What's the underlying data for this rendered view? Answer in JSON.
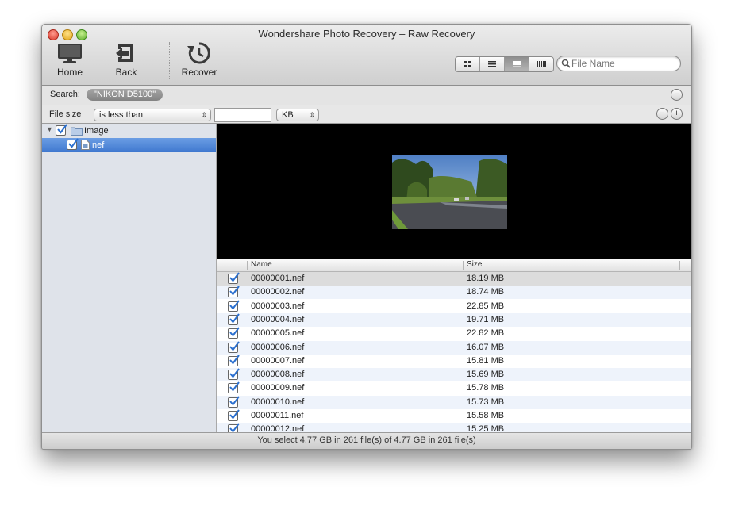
{
  "window": {
    "title": "Wondershare Photo Recovery – Raw Recovery"
  },
  "toolbar": {
    "buttons": [
      {
        "label": "Home",
        "icon": "monitor-icon"
      },
      {
        "label": "Back",
        "icon": "back-arrow-icon"
      },
      {
        "label": "Recover",
        "icon": "history-clock-icon"
      }
    ],
    "view_modes": [
      {
        "name": "grid-view-icon",
        "active": false
      },
      {
        "name": "list-view-icon",
        "active": false
      },
      {
        "name": "preview-view-icon",
        "active": true
      },
      {
        "name": "filmstrip-view-icon",
        "active": false
      }
    ],
    "search": {
      "placeholder": "File Name",
      "value": ""
    }
  },
  "searchbar": {
    "label": "Search:",
    "token": "\"NIKON D5100\"",
    "remove_icon": "minus-circle-icon"
  },
  "filter": {
    "label": "File size",
    "operator": "is less than",
    "value": "",
    "unit": "KB",
    "remove_icon": "minus-circle-icon",
    "add_icon": "plus-circle-icon"
  },
  "tree": {
    "items": [
      {
        "label": "Image",
        "checked": true,
        "expanded": true,
        "icon": "folder-icon"
      },
      {
        "label": "nef",
        "checked": true,
        "selected": true,
        "icon": "file-icon"
      }
    ]
  },
  "preview": {
    "description_icon": "photo-preview"
  },
  "table": {
    "columns": {
      "name": "Name",
      "size": "Size"
    },
    "rows": [
      {
        "name": "00000001.nef",
        "size": "18.19 MB",
        "checked": true
      },
      {
        "name": "00000002.nef",
        "size": "18.74 MB",
        "checked": true
      },
      {
        "name": "00000003.nef",
        "size": "22.85 MB",
        "checked": true
      },
      {
        "name": "00000004.nef",
        "size": "19.71 MB",
        "checked": true
      },
      {
        "name": "00000005.nef",
        "size": "22.82 MB",
        "checked": true
      },
      {
        "name": "00000006.nef",
        "size": "16.07 MB",
        "checked": true
      },
      {
        "name": "00000007.nef",
        "size": "15.81 MB",
        "checked": true
      },
      {
        "name": "00000008.nef",
        "size": "15.69 MB",
        "checked": true
      },
      {
        "name": "00000009.nef",
        "size": "15.78 MB",
        "checked": true
      },
      {
        "name": "00000010.nef",
        "size": "15.73 MB",
        "checked": true
      },
      {
        "name": "00000011.nef",
        "size": "15.58 MB",
        "checked": true
      },
      {
        "name": "00000012.nef",
        "size": "15.25 MB",
        "checked": true
      }
    ]
  },
  "status": {
    "text": "You select 4.77 GB in 261 file(s) of 4.77 GB in 261 file(s)"
  },
  "colors": {
    "selection": "#3f78cf",
    "row_alt": "#eef3fb",
    "row_selected": "#dcdcdc",
    "check_blue": "#2a6fcf"
  }
}
